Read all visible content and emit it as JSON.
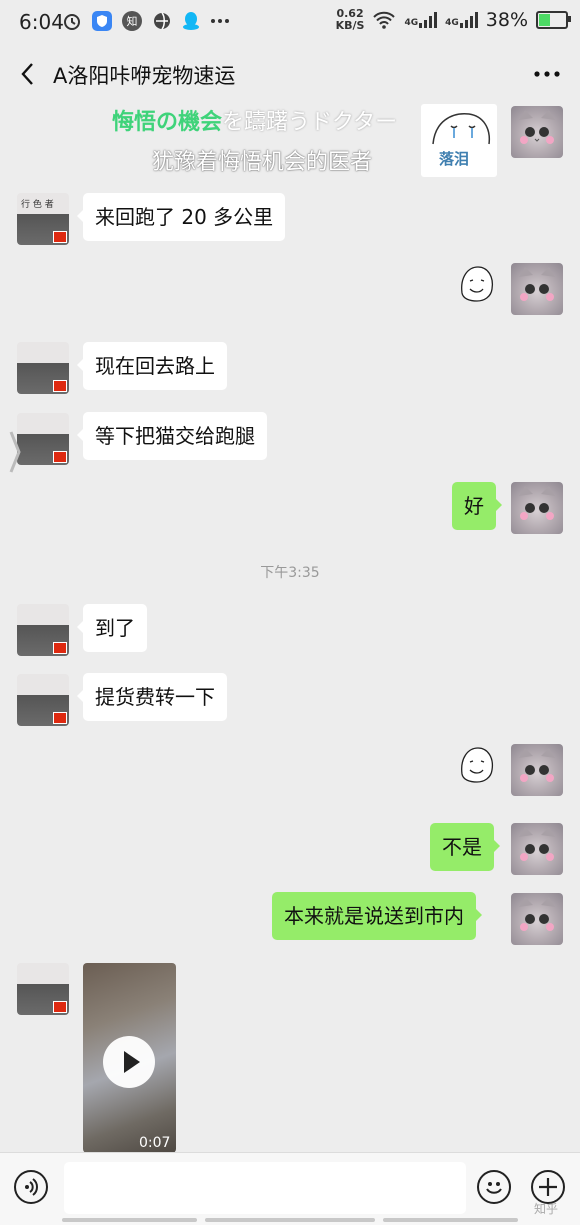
{
  "status_bar": {
    "time": "6:04",
    "net_speed_value": "0.62",
    "net_speed_unit": "KB/S",
    "signal1_label": "4G",
    "signal2_label": "4G",
    "battery": "38%",
    "battery_level": 0.38,
    "icons": [
      "alarm-icon",
      "shield-app-icon",
      "zhihu-app-icon",
      "browser-app-icon",
      "qq-app-icon",
      "more-dots-icon"
    ],
    "app_icon_glyphs": {
      "zhihu": "知"
    }
  },
  "header": {
    "title": "A洛阳咔咿宠物速运"
  },
  "meme": {
    "line1_highlight": "悔悟の機会",
    "line1_rest": "を躊躇うドクター",
    "line2": "犹豫着悔悟机会的医者",
    "card_text": "落泪"
  },
  "messages": [
    {
      "side": "left",
      "type": "text",
      "text": "来回跑了 20 多公里"
    },
    {
      "side": "right",
      "type": "sticker"
    },
    {
      "side": "left",
      "type": "text",
      "text": "现在回去路上"
    },
    {
      "side": "left",
      "type": "text",
      "text": "等下把猫交给跑腿"
    },
    {
      "side": "right",
      "type": "text",
      "text": "好"
    },
    {
      "type": "timestamp",
      "text": "下午3:35"
    },
    {
      "side": "left",
      "type": "text",
      "text": "到了"
    },
    {
      "side": "left",
      "type": "text",
      "text": "提货费转一下"
    },
    {
      "side": "right",
      "type": "sticker"
    },
    {
      "side": "right",
      "type": "text",
      "text": "不是"
    },
    {
      "side": "right",
      "type": "text",
      "text": "本来就是说送到市内"
    },
    {
      "side": "left",
      "type": "video",
      "duration": "0:07"
    }
  ],
  "store_sign": "行 色 者",
  "input_bar": {
    "placeholder": "",
    "watermark": "知乎"
  },
  "colors": {
    "background": "#ededed",
    "bubble_self": "#95ec69",
    "bubble_other": "#ffffff",
    "meme_highlight": "#3fd37a"
  }
}
